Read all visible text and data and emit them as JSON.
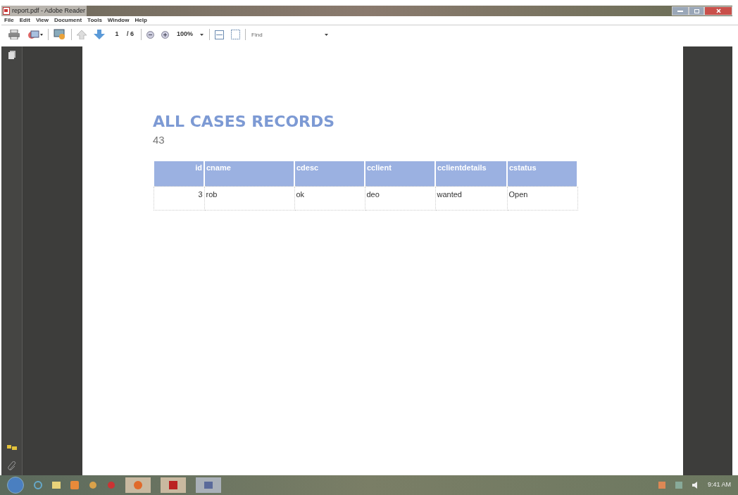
{
  "window": {
    "title": "report.pdf - Adobe Reader"
  },
  "menu": [
    "File",
    "Edit",
    "View",
    "Document",
    "Tools",
    "Window",
    "Help"
  ],
  "toolbar": {
    "page_number": "1",
    "page_total": "/ 6",
    "zoom": "100%",
    "find": {
      "placeholder": "Find"
    }
  },
  "document": {
    "title": "ALL CASES RECORDS",
    "count": "43",
    "table": {
      "columns": [
        "id",
        "cname",
        "cdesc",
        "cclient",
        "cclientdetails",
        "cstatus"
      ],
      "rows": [
        [
          "3",
          "rob",
          "ok",
          "deo",
          "wanted",
          "Open"
        ]
      ]
    }
  },
  "taskbar": {
    "clock": "9:41 AM"
  }
}
